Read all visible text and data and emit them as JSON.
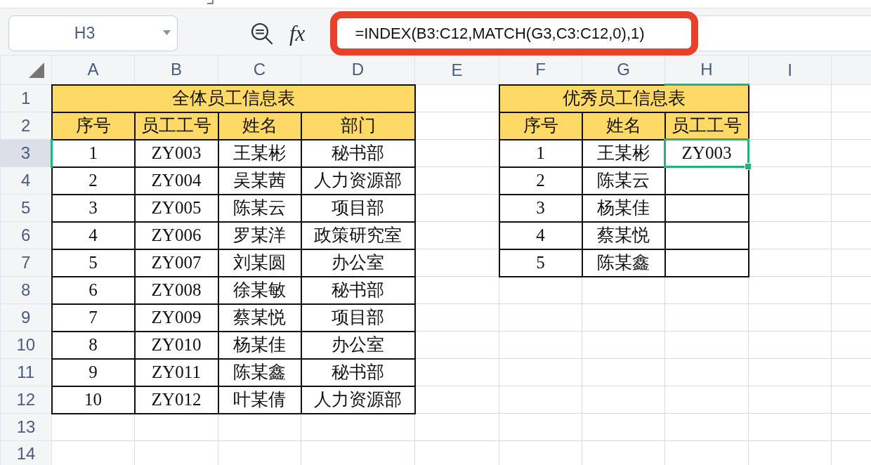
{
  "name_box": {
    "value": "H3"
  },
  "function_button": {
    "label": "fx"
  },
  "formula_bar": {
    "value": "=INDEX(B3:C12,MATCH(G3,C3:C12,0),1)",
    "highlighted": true
  },
  "columns": [
    {
      "label": "A",
      "selected": false
    },
    {
      "label": "B",
      "selected": false
    },
    {
      "label": "C",
      "selected": false
    },
    {
      "label": "D",
      "selected": false
    },
    {
      "label": "E",
      "selected": false
    },
    {
      "label": "F",
      "selected": false
    },
    {
      "label": "G",
      "selected": false
    },
    {
      "label": "H",
      "selected": true
    },
    {
      "label": "I",
      "selected": false
    }
  ],
  "rows": [
    {
      "label": "1",
      "selected": false
    },
    {
      "label": "2",
      "selected": false
    },
    {
      "label": "3",
      "selected": true
    },
    {
      "label": "4",
      "selected": false
    },
    {
      "label": "5",
      "selected": false
    },
    {
      "label": "6",
      "selected": false
    },
    {
      "label": "7",
      "selected": false
    },
    {
      "label": "8",
      "selected": false
    },
    {
      "label": "9",
      "selected": false
    },
    {
      "label": "10",
      "selected": false
    },
    {
      "label": "11",
      "selected": false
    },
    {
      "label": "12",
      "selected": false
    },
    {
      "label": "13",
      "selected": false
    },
    {
      "label": "14",
      "selected": false
    }
  ],
  "tables": [
    {
      "title": "全体员工信息表",
      "headers": [
        "序号",
        "员工工号",
        "姓名",
        "部门"
      ],
      "rows": [
        {
          "cells": [
            {
              "text": "1",
              "selected": false
            },
            {
              "text": "ZY003",
              "selected": false
            },
            {
              "text": "王某彬",
              "selected": false
            },
            {
              "text": "秘书部",
              "selected": false
            }
          ]
        },
        {
          "cells": [
            {
              "text": "2",
              "selected": false
            },
            {
              "text": "ZY004",
              "selected": false
            },
            {
              "text": "吴某茜",
              "selected": false
            },
            {
              "text": "人力资源部",
              "selected": false
            }
          ]
        },
        {
          "cells": [
            {
              "text": "3",
              "selected": false
            },
            {
              "text": "ZY005",
              "selected": false
            },
            {
              "text": "陈某云",
              "selected": false
            },
            {
              "text": "项目部",
              "selected": false
            }
          ]
        },
        {
          "cells": [
            {
              "text": "4",
              "selected": false
            },
            {
              "text": "ZY006",
              "selected": false
            },
            {
              "text": "罗某洋",
              "selected": false
            },
            {
              "text": "政策研究室",
              "selected": false
            }
          ]
        },
        {
          "cells": [
            {
              "text": "5",
              "selected": false
            },
            {
              "text": "ZY007",
              "selected": false
            },
            {
              "text": "刘某圆",
              "selected": false
            },
            {
              "text": "办公室",
              "selected": false
            }
          ]
        },
        {
          "cells": [
            {
              "text": "6",
              "selected": false
            },
            {
              "text": "ZY008",
              "selected": false
            },
            {
              "text": "徐某敏",
              "selected": false
            },
            {
              "text": "秘书部",
              "selected": false
            }
          ]
        },
        {
          "cells": [
            {
              "text": "7",
              "selected": false
            },
            {
              "text": "ZY009",
              "selected": false
            },
            {
              "text": "蔡某悦",
              "selected": false
            },
            {
              "text": "项目部",
              "selected": false
            }
          ]
        },
        {
          "cells": [
            {
              "text": "8",
              "selected": false
            },
            {
              "text": "ZY010",
              "selected": false
            },
            {
              "text": "杨某佳",
              "selected": false
            },
            {
              "text": "办公室",
              "selected": false
            }
          ]
        },
        {
          "cells": [
            {
              "text": "9",
              "selected": false
            },
            {
              "text": "ZY011",
              "selected": false
            },
            {
              "text": "陈某鑫",
              "selected": false
            },
            {
              "text": "秘书部",
              "selected": false
            }
          ]
        },
        {
          "cells": [
            {
              "text": "10",
              "selected": false
            },
            {
              "text": "ZY012",
              "selected": false
            },
            {
              "text": "叶某倩",
              "selected": false
            },
            {
              "text": "人力资源部",
              "selected": false
            }
          ]
        }
      ]
    },
    {
      "title": "优秀员工信息表",
      "headers": [
        "序号",
        "姓名",
        "员工工号"
      ],
      "rows": [
        {
          "cells": [
            {
              "text": "1",
              "selected": false
            },
            {
              "text": "王某彬",
              "selected": false
            },
            {
              "text": "ZY003",
              "selected": true
            }
          ]
        },
        {
          "cells": [
            {
              "text": "2",
              "selected": false
            },
            {
              "text": "陈某云",
              "selected": false
            },
            {
              "selected": false
            }
          ]
        },
        {
          "cells": [
            {
              "text": "3",
              "selected": false
            },
            {
              "text": "杨某佳",
              "selected": false
            },
            {
              "selected": false
            }
          ]
        },
        {
          "cells": [
            {
              "text": "4",
              "selected": false
            },
            {
              "text": "蔡某悦",
              "selected": false
            },
            {
              "selected": false
            }
          ]
        },
        {
          "cells": [
            {
              "text": "5",
              "selected": false
            },
            {
              "text": "陈某鑫",
              "selected": false
            },
            {
              "selected": false
            }
          ]
        }
      ]
    }
  ]
}
